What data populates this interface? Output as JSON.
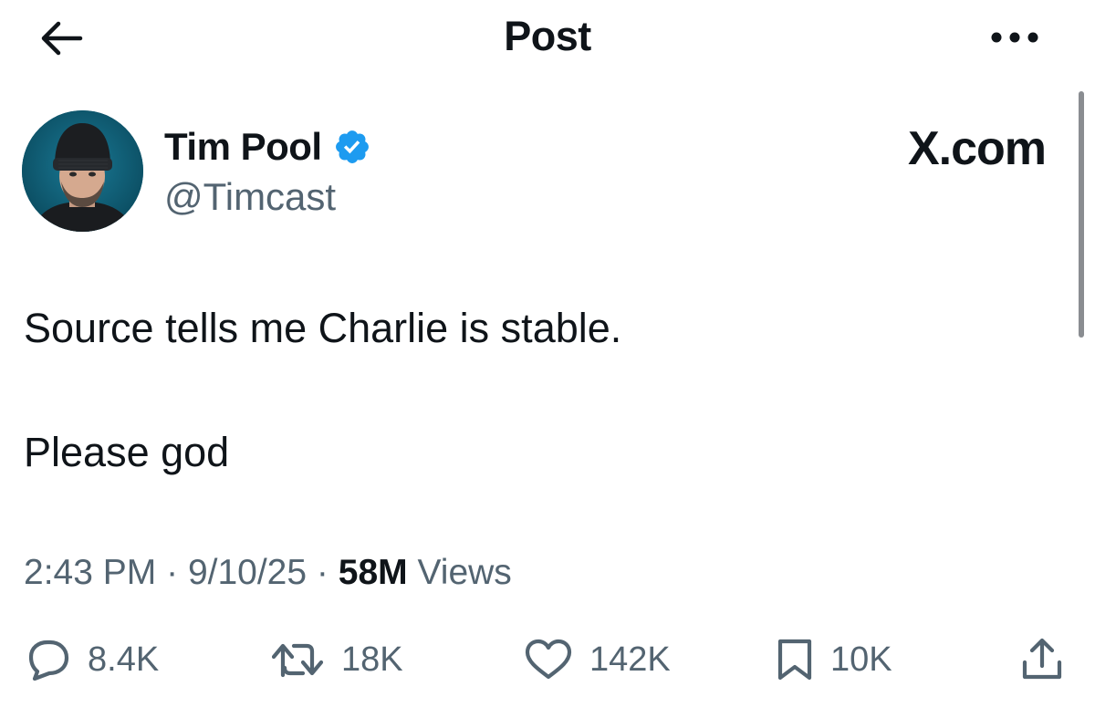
{
  "header": {
    "title": "Post",
    "back_icon": "arrow-left-icon",
    "more_icon": "more-horizontal-icon"
  },
  "author": {
    "name": "Tim Pool",
    "handle": "@Timcast",
    "verified": true,
    "verified_color": "#1d9bf0"
  },
  "watermark": "X.com",
  "post": {
    "lines": [
      "Source tells me Charlie is stable.",
      "Please god"
    ]
  },
  "meta": {
    "time": "2:43 PM",
    "separator": "·",
    "date": "9/10/25",
    "views_count": "58M",
    "views_label": "Views"
  },
  "actions": {
    "replies": "8.4K",
    "reposts": "18K",
    "likes": "142K",
    "bookmarks": "10K"
  },
  "colors": {
    "text_primary": "#0f1419",
    "text_secondary": "#536471",
    "verified_blue": "#1d9bf0"
  }
}
